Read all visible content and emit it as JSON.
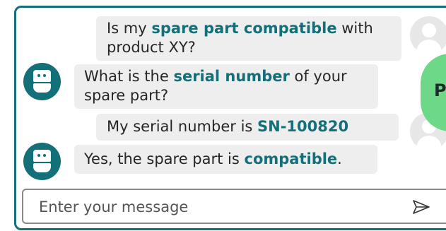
{
  "chat": {
    "messages": [
      {
        "role": "user",
        "pre": "Is my ",
        "hl": "spare part compatible",
        "post": " with product XY?"
      },
      {
        "role": "bot",
        "pre": "What is the ",
        "hl": "serial number",
        "post": " of your spare part?"
      },
      {
        "role": "user",
        "pre": "My serial number is ",
        "hl": "SN-100820",
        "post": ""
      },
      {
        "role": "bot",
        "pre": "Yes, the spare part is ",
        "hl": "compatible",
        "post": "."
      }
    ]
  },
  "side_badge": {
    "label": "P"
  },
  "input": {
    "placeholder": "Enter your message"
  },
  "icons": {
    "user": "user-avatar-icon",
    "bot": "robot-icon",
    "send": "send-icon"
  },
  "colors": {
    "accent": "#136f78",
    "bubble": "#eeeeee",
    "badge": "#6dd888"
  }
}
